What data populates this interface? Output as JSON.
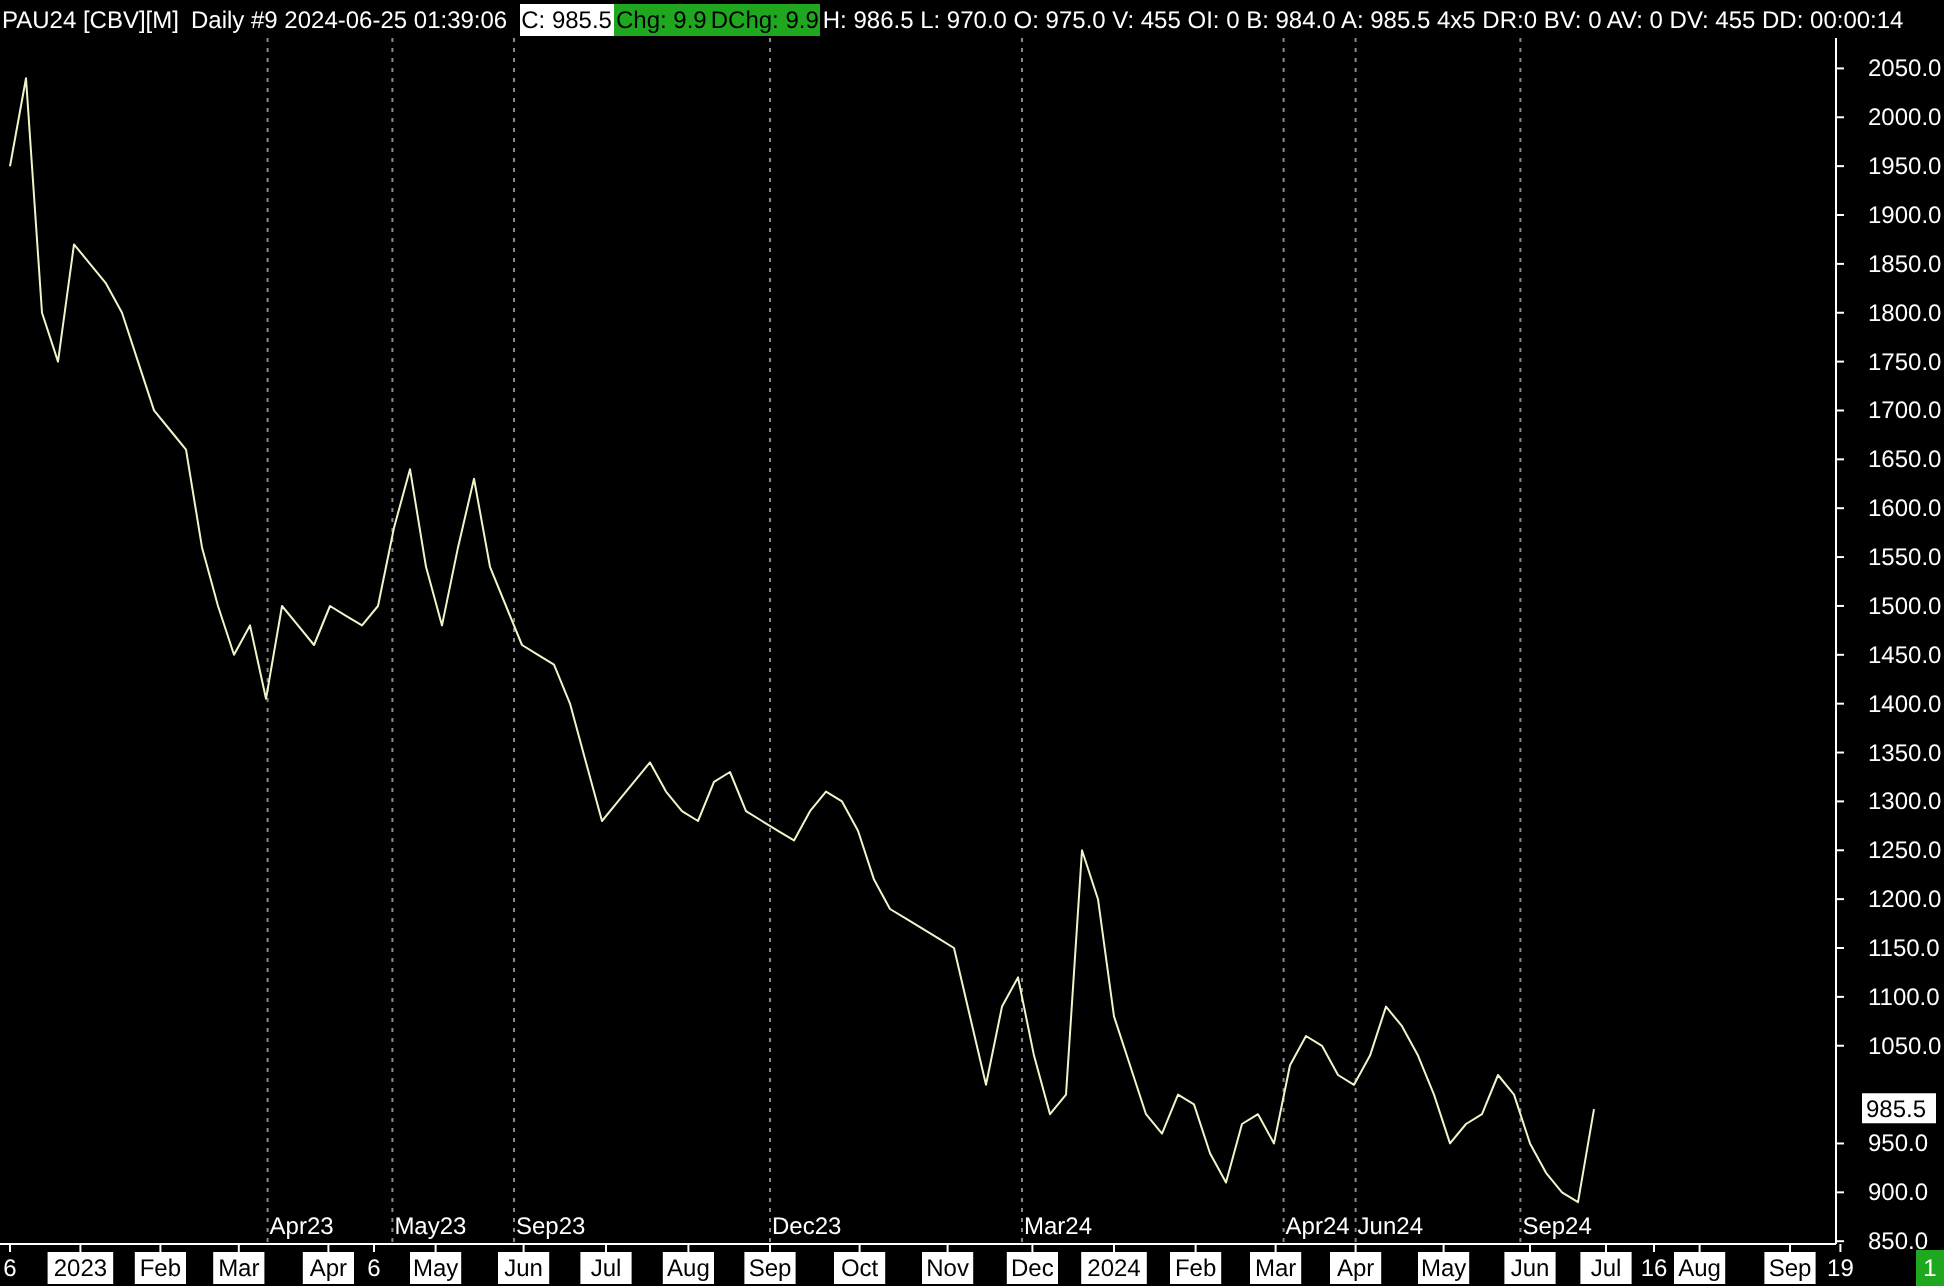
{
  "header": {
    "symbol": "PAU24 [CBV][M]",
    "session": "Daily #9 2024-06-25 01:39:06",
    "fields": [
      {
        "kind": "white",
        "text": "C: 985.5"
      },
      {
        "kind": "green",
        "text": "Chg: 9.9"
      },
      {
        "kind": "green",
        "text": "DChg: 9.9"
      },
      {
        "kind": "plain",
        "text": "H: 986.5 L: 970.0 O: 975.0 V: 455 OI: 0 B: 984.0 A: 985.5 4x5 DR:0 BV: 0 AV: 0 DV: 455 DD: 00:00:14"
      }
    ]
  },
  "chart": {
    "chart_data": {
      "type": "line",
      "series": [
        {
          "color": "#eef5c8",
          "values": [
            1950,
            2040,
            1800,
            1750,
            1870,
            1850,
            1830,
            1800,
            1750,
            1700,
            1680,
            1660,
            1560,
            1500,
            1450,
            1480,
            1405,
            1500,
            1480,
            1460,
            1500,
            1490,
            1480,
            1500,
            1580,
            1640,
            1540,
            1480,
            1560,
            1630,
            1540,
            1500,
            1460,
            1450,
            1440,
            1400,
            1340,
            1280,
            1300,
            1320,
            1340,
            1310,
            1290,
            1280,
            1320,
            1330,
            1290,
            1280,
            1270,
            1260,
            1290,
            1310,
            1300,
            1270,
            1220,
            1190,
            1180,
            1170,
            1160,
            1150,
            1080,
            1010,
            1090,
            1120,
            1040,
            980,
            1000,
            1250,
            1200,
            1080,
            1030,
            980,
            960,
            1000,
            990,
            940,
            910,
            970,
            980,
            950,
            1030,
            1060,
            1050,
            1020,
            1010,
            1040,
            1090,
            1070,
            1040,
            1000,
            950,
            970,
            980,
            1020,
            1000,
            950,
            920,
            900,
            890,
            985
          ]
        }
      ],
      "ylim": [
        850,
        2120
      ],
      "yticks": [
        {
          "value": 850,
          "label": "850.0"
        },
        {
          "value": 900,
          "label": "900.0"
        },
        {
          "value": 950,
          "label": "950.0"
        },
        {
          "value": 1050,
          "label": "1050.0"
        },
        {
          "value": 1100,
          "label": "1100.0"
        },
        {
          "value": 1150,
          "label": "1150.0"
        },
        {
          "value": 1200,
          "label": "1200.0"
        },
        {
          "value": 1250,
          "label": "1250.0"
        },
        {
          "value": 1300,
          "label": "1300.0"
        },
        {
          "value": 1350,
          "label": "1350.0"
        },
        {
          "value": 1400,
          "label": "1400.0"
        },
        {
          "value": 1450,
          "label": "1450.0"
        },
        {
          "value": 1500,
          "label": "1500.0"
        },
        {
          "value": 1550,
          "label": "1550.0"
        },
        {
          "value": 1600,
          "label": "1600.0"
        },
        {
          "value": 1650,
          "label": "1650.0"
        },
        {
          "value": 1700,
          "label": "1700.0"
        },
        {
          "value": 1750,
          "label": "1750.0"
        },
        {
          "value": 1800,
          "label": "1800.0"
        },
        {
          "value": 1850,
          "label": "1850.0"
        },
        {
          "value": 1900,
          "label": "1900.0"
        },
        {
          "value": 1950,
          "label": "1950.0"
        },
        {
          "value": 2000,
          "label": "2000.0"
        },
        {
          "value": 2050,
          "label": "2050.0"
        }
      ]
    },
    "period_markers": [
      "Apr23",
      "May23",
      "Sep23",
      "Dec23",
      "Mar24",
      "Apr24",
      "Jun24",
      "Sep24"
    ],
    "date_axis": [
      {
        "label": "6",
        "boxed": false
      },
      {
        "label": "2023",
        "boxed": true
      },
      {
        "label": "Feb",
        "boxed": true
      },
      {
        "label": "Mar",
        "boxed": true
      },
      {
        "label": "Apr",
        "boxed": true
      },
      {
        "label": "6",
        "boxed": false
      },
      {
        "label": "May",
        "boxed": true
      },
      {
        "label": "Jun",
        "boxed": true
      },
      {
        "label": "Jul",
        "boxed": true
      },
      {
        "label": "Aug",
        "boxed": true
      },
      {
        "label": "Sep",
        "boxed": true
      },
      {
        "label": "Oct",
        "boxed": true
      },
      {
        "label": "Nov",
        "boxed": true
      },
      {
        "label": "Dec",
        "boxed": true
      },
      {
        "label": "2024",
        "boxed": true
      },
      {
        "label": "Feb",
        "boxed": true
      },
      {
        "label": "Mar",
        "boxed": true
      },
      {
        "label": "Apr",
        "boxed": true
      },
      {
        "label": "May",
        "boxed": true
      },
      {
        "label": "Jun",
        "boxed": true
      },
      {
        "label": "Jul",
        "boxed": true
      },
      {
        "label": "16",
        "boxed": false
      },
      {
        "label": "Aug",
        "boxed": true
      },
      {
        "label": "Sep",
        "boxed": true
      },
      {
        "label": "19",
        "boxed": false
      }
    ],
    "last_price": "985.5",
    "corner_badge": "1"
  }
}
